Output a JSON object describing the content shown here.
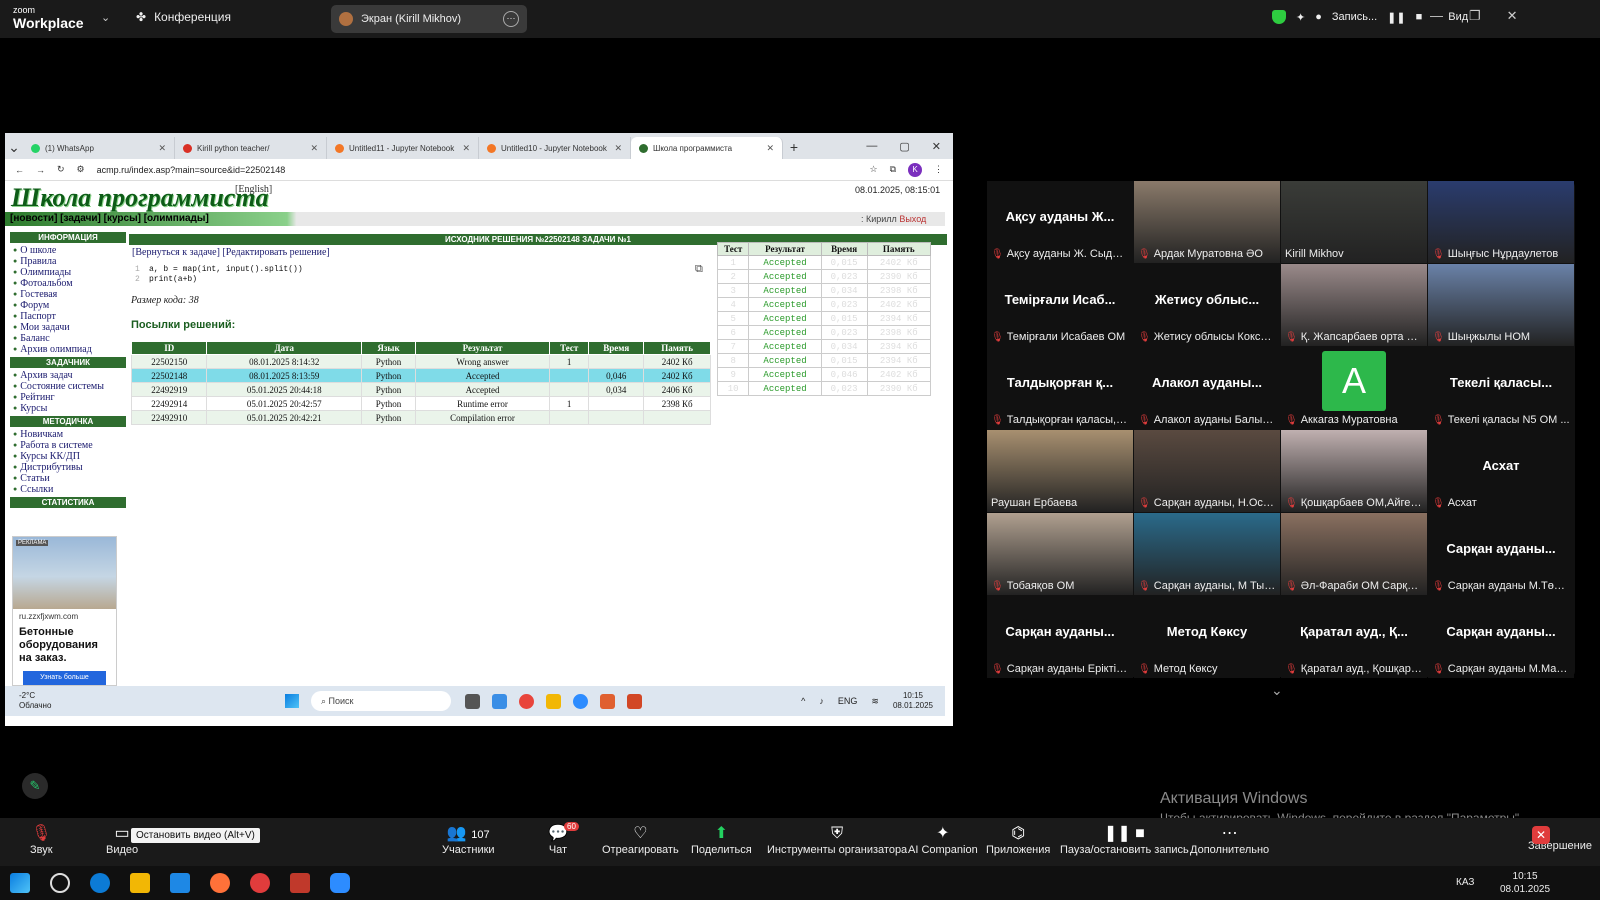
{
  "zoom": {
    "brand_small": "zoom",
    "brand": "Workplace",
    "conference": "Конференция",
    "screen_share": "Экран (Kirill Mikhov)",
    "recording": "Запись...",
    "view": "Вид"
  },
  "browser": {
    "tabs": [
      {
        "label": "(1) WhatsApp",
        "color": "#25d366"
      },
      {
        "label": "Kirill python teacher/",
        "color": "#d93025"
      },
      {
        "label": "Untitled11 - Jupyter Notebook",
        "color": "#f37726"
      },
      {
        "label": "Untitled10 - Jupyter Notebook",
        "color": "#f37726"
      },
      {
        "label": "Школа программиста",
        "color": "#2f6d2f"
      }
    ],
    "url": "acmp.ru/index.asp?main=source&id=22502148",
    "avatar": "K"
  },
  "acmp": {
    "title": "Школа программиста",
    "english": "[English]",
    "datetime": "08.01.2025, 08:15:01",
    "nav": "[новости] [задачи] [курсы] [олимпиады]",
    "nav_right_1": ": Кирилл",
    "nav_right_2": "Выход",
    "sidebar": [
      {
        "head": "ИНФОРМАЦИЯ",
        "items": [
          "О школе",
          "Правила",
          "Олимпиады",
          "Фотоальбом",
          "Гостевая",
          "Форум",
          "Паспорт",
          "Мои задачи",
          "Баланс",
          "Архив олимпиад"
        ]
      },
      {
        "head": "ЗАДАЧНИК",
        "items": [
          "Архив задач",
          "Состояние системы",
          "Рейтинг",
          "Курсы"
        ]
      },
      {
        "head": "МЕТОДИЧКА",
        "items": [
          "Новичкам",
          "Работа в системе",
          "Курсы КК/ДП",
          "Дистрибутивы",
          "Статьи",
          "Ссылки"
        ]
      },
      {
        "head": "СТАТИСТИКА",
        "items": []
      }
    ],
    "ad": {
      "label": "РЕКЛАМА",
      "site": "ru.zzxfjxwm.com",
      "text": "Бетонные оборудования на заказ.",
      "button": "Узнать больше"
    },
    "main_header": "ИСХОДНИК РЕШЕНИЯ №22502148 ЗАДАЧИ №1",
    "links": "[Вернуться к задаче] [Редактировать решение]",
    "code": [
      "a, b = map(int, input().split())",
      "print(a+b)"
    ],
    "code_size": "Размер кода: 38",
    "subs_title": "Посылки решений:",
    "subs_headers": [
      "ID",
      "Дата",
      "Язык",
      "Результат",
      "Тест",
      "Время",
      "Память"
    ],
    "subs": [
      [
        "22502150",
        "08.01.2025 8:14:32",
        "Python",
        "Wrong answer",
        "1",
        "",
        "2402 Кб"
      ],
      [
        "22502148",
        "08.01.2025 8:13:59",
        "Python",
        "Accepted",
        "",
        "0,046",
        "2402 Кб"
      ],
      [
        "22492919",
        "05.01.2025 20:44:18",
        "Python",
        "Accepted",
        "",
        "0,034",
        "2406 Кб"
      ],
      [
        "22492914",
        "05.01.2025 20:42:57",
        "Python",
        "Runtime error",
        "1",
        "",
        "2398 Кб"
      ],
      [
        "22492910",
        "05.01.2025 20:42:21",
        "Python",
        "Compilation error",
        "",
        "",
        ""
      ]
    ],
    "tests_headers": [
      "Тест",
      "Результат",
      "Время",
      "Память"
    ],
    "tests": [
      [
        "1",
        "Accepted",
        "0,015",
        "2402 Кб"
      ],
      [
        "2",
        "Accepted",
        "0,023",
        "2390 Кб"
      ],
      [
        "3",
        "Accepted",
        "0,034",
        "2398 Кб"
      ],
      [
        "4",
        "Accepted",
        "0,023",
        "2402 Кб"
      ],
      [
        "5",
        "Accepted",
        "0,015",
        "2394 Кб"
      ],
      [
        "6",
        "Accepted",
        "0,023",
        "2398 Кб"
      ],
      [
        "7",
        "Accepted",
        "0,034",
        "2394 Кб"
      ],
      [
        "8",
        "Accepted",
        "0,015",
        "2394 Кб"
      ],
      [
        "9",
        "Accepted",
        "0,046",
        "2402 Кб"
      ],
      [
        "10",
        "Accepted",
        "0,023",
        "2390 Кб"
      ]
    ]
  },
  "inner_taskbar": {
    "temp": "-2°C",
    "weather": "Облачно",
    "search": "Поиск",
    "lang": "ENG",
    "time": "10:15",
    "date": "08.01.2025"
  },
  "gallery": [
    {
      "name": "Ақсу ауданы Ж...",
      "cap": "Ақсу ауданы Ж. Сыдык...",
      "mic_off": true
    },
    {
      "name": "",
      "cap": "Ардак Муратовна ӘО",
      "mic_off": true,
      "video": "#8a7a6a"
    },
    {
      "name": "",
      "cap": "Kirill Mikhov",
      "mic_off": false,
      "video": "#3a3c38",
      "speaking": true
    },
    {
      "name": "",
      "cap": "Шыңғыс Нұрдаулетов",
      "mic_off": true,
      "video": "#2a3c6e"
    },
    {
      "name": "Темірғали Исаб...",
      "cap": "Темірғали Исабаев ОМ",
      "mic_off": true
    },
    {
      "name": "Жетису облыс...",
      "cap": "Жетису облысы Коксу а...",
      "mic_off": true
    },
    {
      "name": "",
      "cap": "Қ. Жапсарбаев орта ме...",
      "mic_off": true,
      "video": "#9a8a8a"
    },
    {
      "name": "",
      "cap": "Шыңжылы НОМ",
      "mic_off": true,
      "video": "#6a82a8"
    },
    {
      "name": "Талдықорған қ...",
      "cap": "Талдықорған қаласы,1...",
      "mic_off": true
    },
    {
      "name": "Алакол ауданы...",
      "cap": "Алакол ауданы Балым ...",
      "mic_off": true
    },
    {
      "name": "",
      "cap": "Аккагаз Муратовна",
      "mic_off": true,
      "letter": "A"
    },
    {
      "name": "Текелі қаласы...",
      "cap": "Текелі қаласы N5 ОМ ...",
      "mic_off": true
    },
    {
      "name": "",
      "cap": "Раушан Ербаева",
      "mic_off": false,
      "video": "#a89070"
    },
    {
      "name": "",
      "cap": "Сарқан ауданы, Н.Остр...",
      "mic_off": true,
      "video": "#5a4a40"
    },
    {
      "name": "",
      "cap": "Қошқарбаев ОМ,Айгер...",
      "mic_off": true,
      "video": "#c0b0b0"
    },
    {
      "name": "Асхат",
      "cap": "Асхат",
      "mic_off": true
    },
    {
      "name": "",
      "cap": "Тобаяқов ОМ",
      "mic_off": true,
      "video": "#b0a090"
    },
    {
      "name": "",
      "cap": "Сарқан ауданы, М Тын...",
      "mic_off": true,
      "video": "#2a6a8a"
    },
    {
      "name": "",
      "cap": "Әл-Фараби ОМ Сарқан...",
      "mic_off": true,
      "video": "#8a7060"
    },
    {
      "name": "Сарқан ауданы...",
      "cap": "Сарқан ауданы М.Төле...",
      "mic_off": true
    },
    {
      "name": "Сарқан ауданы...",
      "cap": "Сарқан ауданы Ерікті О...",
      "mic_off": true
    },
    {
      "name": "Метод Көксу",
      "cap": "Метод Көксу",
      "mic_off": true
    },
    {
      "name": "Қаратал ауд., Қ...",
      "cap": "Қаратал ауд., Қошқарб...",
      "mic_off": true
    },
    {
      "name": "Сарқан ауданы...",
      "cap": "Сарқан ауданы М.Мам...",
      "mic_off": true
    }
  ],
  "watermark": {
    "line1": "Активация Windows",
    "line2": "Чтобы активировать Windows, перейдите в раздел \"Параметры\"."
  },
  "toolbar": {
    "sound": "Звук",
    "video": "Видео",
    "tooltip": "Остановить видео (Alt+V)",
    "participants_count": "107",
    "participants": "Участники",
    "chat_badge": "60",
    "chat": "Чат",
    "react": "Отреагировать",
    "share": "Поделиться",
    "host_tools": "Инструменты организатора",
    "ai": "AI Companion",
    "apps": "Приложения",
    "pause_rec": "Пауза/остановить запись",
    "more": "Дополнительно",
    "end": "Завершение"
  },
  "win_taskbar": {
    "lang": "КАЗ",
    "time": "10:15",
    "date": "08.01.2025"
  }
}
